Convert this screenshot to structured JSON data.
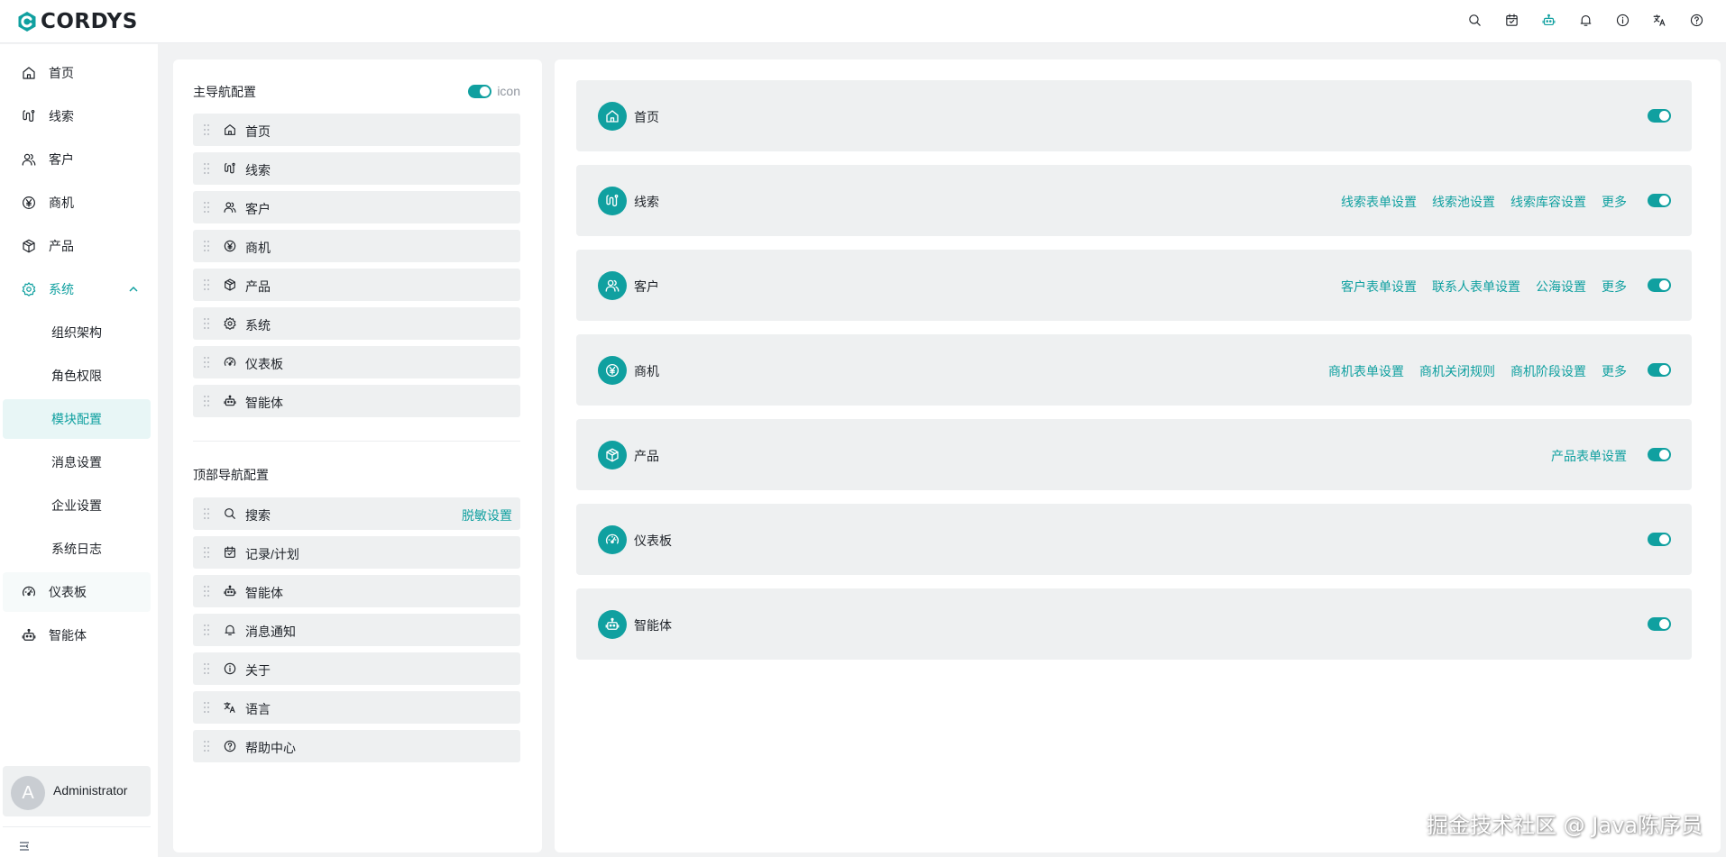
{
  "app": {
    "logo_text": "CORDYS"
  },
  "colors": {
    "accent": "#10a0a0",
    "active_bg": "#e8f6f6",
    "card_bg": "#eef0f1"
  },
  "top_icons": [
    "search-icon",
    "calendar-icon",
    "robot-icon",
    "bell-icon",
    "info-icon",
    "translate-icon",
    "help-icon"
  ],
  "sidebar": {
    "items": [
      {
        "label": "首页",
        "icon": "home-icon"
      },
      {
        "label": "线索",
        "icon": "clue-icon"
      },
      {
        "label": "客户",
        "icon": "customer-icon"
      },
      {
        "label": "商机",
        "icon": "yen-icon"
      },
      {
        "label": "产品",
        "icon": "box-icon"
      },
      {
        "label": "系统",
        "icon": "gear-icon",
        "expanded": true
      },
      {
        "label": "组织架构"
      },
      {
        "label": "角色权限"
      },
      {
        "label": "模块配置",
        "active": true
      },
      {
        "label": "消息设置"
      },
      {
        "label": "企业设置"
      },
      {
        "label": "系统日志"
      },
      {
        "label": "仪表板",
        "icon": "dashboard-icon"
      },
      {
        "label": "智能体",
        "icon": "robot-icon"
      }
    ],
    "user": {
      "avatar_letter": "A",
      "name": "Administrator"
    }
  },
  "config": {
    "main_nav_title": "主导航配置",
    "icon_toggle_label": "icon",
    "main_nav": [
      {
        "label": "首页",
        "icon": "home-icon"
      },
      {
        "label": "线索",
        "icon": "clue-icon"
      },
      {
        "label": "客户",
        "icon": "customer-icon"
      },
      {
        "label": "商机",
        "icon": "yen-icon"
      },
      {
        "label": "产品",
        "icon": "box-icon"
      },
      {
        "label": "系统",
        "icon": "gear-icon"
      },
      {
        "label": "仪表板",
        "icon": "dashboard-icon"
      },
      {
        "label": "智能体",
        "icon": "robot-icon"
      }
    ],
    "top_nav_title": "顶部导航配置",
    "top_nav": [
      {
        "label": "搜索",
        "icon": "search-icon",
        "link": "脱敏设置"
      },
      {
        "label": "记录/计划",
        "icon": "calendar-icon"
      },
      {
        "label": "智能体",
        "icon": "robot-icon"
      },
      {
        "label": "消息通知",
        "icon": "bell-icon"
      },
      {
        "label": "关于",
        "icon": "info-icon"
      },
      {
        "label": "语言",
        "icon": "translate-icon"
      },
      {
        "label": "帮助中心",
        "icon": "help-icon"
      }
    ]
  },
  "modules": [
    {
      "name": "首页",
      "icon": "home-icon",
      "links": [],
      "enabled": true
    },
    {
      "name": "线索",
      "icon": "clue-icon",
      "links": [
        "线索表单设置",
        "线索池设置",
        "线索库容设置",
        "更多"
      ],
      "enabled": true
    },
    {
      "name": "客户",
      "icon": "customer-icon",
      "links": [
        "客户表单设置",
        "联系人表单设置",
        "公海设置",
        "更多"
      ],
      "enabled": true
    },
    {
      "name": "商机",
      "icon": "yen-icon",
      "links": [
        "商机表单设置",
        "商机关闭规则",
        "商机阶段设置",
        "更多"
      ],
      "enabled": true
    },
    {
      "name": "产品",
      "icon": "box-icon",
      "links": [
        "产品表单设置"
      ],
      "enabled": true
    },
    {
      "name": "仪表板",
      "icon": "dashboard-icon",
      "links": [],
      "enabled": true
    },
    {
      "name": "智能体",
      "icon": "robot-icon",
      "links": [],
      "enabled": true
    }
  ],
  "watermark": "掘金技术社区 @ Java陈序员"
}
